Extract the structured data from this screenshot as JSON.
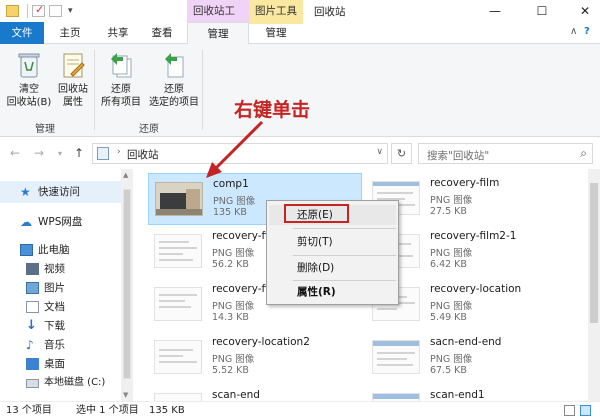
{
  "window": {
    "title": "回收站",
    "contextual_tabs": [
      "回收站工具",
      "图片工具"
    ],
    "controls": {
      "minimize": "—",
      "maximize": "☐",
      "close": "✕"
    }
  },
  "tabs": [
    {
      "label": "文件"
    },
    {
      "label": "主页"
    },
    {
      "label": "共享"
    },
    {
      "label": "查看"
    },
    {
      "label": "管理"
    },
    {
      "label": "管理"
    }
  ],
  "ribbon": {
    "buttons": [
      {
        "label_line1": "清空",
        "label_line2": "回收站(B)",
        "icon": "recycle-bin-icon"
      },
      {
        "label_line1": "回收站",
        "label_line2": "属性",
        "icon": "properties-icon"
      },
      {
        "label_line1": "还原",
        "label_line2": "所有项目",
        "icon": "restore-all-icon"
      },
      {
        "label_line1": "还原",
        "label_line2": "选定的项目",
        "icon": "restore-selected-icon"
      }
    ],
    "groups": [
      "管理",
      "还原"
    ]
  },
  "address": {
    "path": "回收站",
    "search_placeholder": "搜索\"回收站\""
  },
  "nav_pane": {
    "items": [
      {
        "label": "快速访问",
        "icon": "star-icon",
        "selected": true
      },
      {
        "label": "WPS网盘",
        "icon": "cloud-icon"
      },
      {
        "label": "此电脑",
        "icon": "computer-icon"
      },
      {
        "label": "视频",
        "icon": "video-icon"
      },
      {
        "label": "图片",
        "icon": "picture-icon"
      },
      {
        "label": "文档",
        "icon": "document-icon"
      },
      {
        "label": "下载",
        "icon": "download-icon"
      },
      {
        "label": "音乐",
        "icon": "music-icon"
      },
      {
        "label": "桌面",
        "icon": "desktop-icon"
      },
      {
        "label": "本地磁盘 (C:)",
        "icon": "drive-icon"
      }
    ]
  },
  "files": [
    {
      "name": "comp1",
      "type": "PNG 图像",
      "size": "135 KB",
      "selected": true,
      "photo": true
    },
    {
      "name": "recovery-film",
      "type": "PNG 图像",
      "size": "27.5 KB"
    },
    {
      "name": "recovery-film-",
      "type": "PNG 图像",
      "size": "56.2 KB"
    },
    {
      "name": "recovery-film2-1",
      "type": "PNG 图像",
      "size": "6.42 KB"
    },
    {
      "name": "recovery-film2",
      "type": "PNG 图像",
      "size": "14.3 KB"
    },
    {
      "name": "recovery-location",
      "type": "PNG 图像",
      "size": "5.49 KB"
    },
    {
      "name": "recovery-location2",
      "type": "PNG 图像",
      "size": "5.52 KB"
    },
    {
      "name": "sacn-end-end",
      "type": "PNG 图像",
      "size": "67.5 KB"
    },
    {
      "name": "scan-end",
      "type": "",
      "size": ""
    },
    {
      "name": "scan-end1",
      "type": "",
      "size": ""
    }
  ],
  "context_menu": {
    "items": [
      {
        "label": "还原(E)",
        "highlighted": true
      },
      {
        "label": "剪切(T)"
      },
      {
        "label": "删除(D)"
      },
      {
        "label": "属性(R)",
        "bold": true
      }
    ]
  },
  "annotation": {
    "text": "右键单击",
    "color": "#c42424"
  },
  "status": {
    "count": "13 个项目",
    "selected": "选中 1 个项目",
    "size": "135 KB"
  },
  "colors": {
    "file_tab": "#1979ca",
    "selection": "#cce8ff",
    "recycle_tools": "#f1d3f7",
    "picture_tools": "#fbe8a0"
  }
}
